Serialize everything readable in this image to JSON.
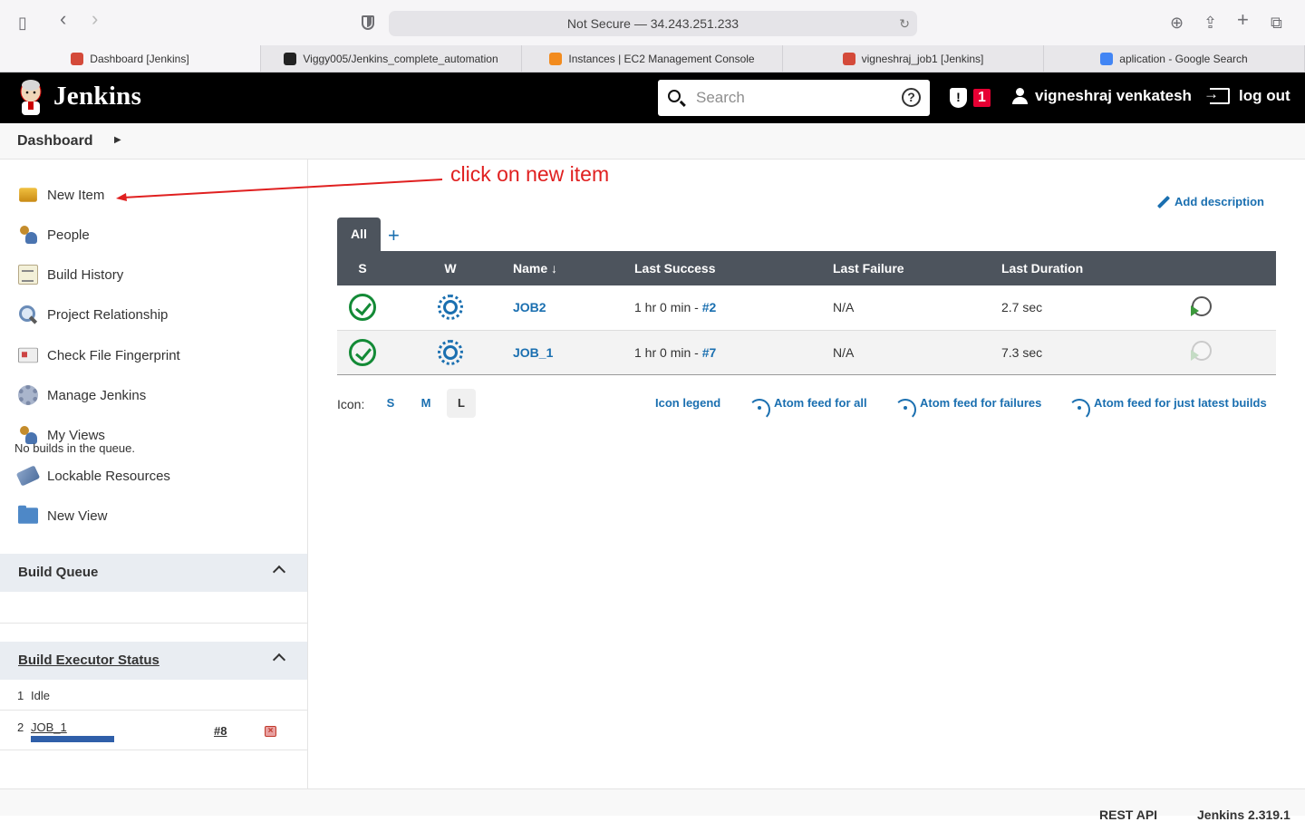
{
  "browser": {
    "url": "Not Secure — 34.243.251.233",
    "tabs": [
      {
        "label": "Dashboard [Jenkins]",
        "color": "#d44a3a"
      },
      {
        "label": "Viggy005/Jenkins_complete_automation",
        "color": "#222222"
      },
      {
        "label": "Instances | EC2 Management Console",
        "color": "#f28b1e"
      },
      {
        "label": "vigneshraj_job1 [Jenkins]",
        "color": "#d44a3a"
      },
      {
        "label": "aplication - Google Search",
        "color": "#4285f4"
      }
    ]
  },
  "header": {
    "title": "Jenkins",
    "search_placeholder": "Search",
    "help": "?",
    "security_mark": "!",
    "alert_count": "1",
    "user": "vigneshraj venkatesh",
    "logout": "log out"
  },
  "breadcrumb": {
    "dashboard": "Dashboard"
  },
  "sidebar": {
    "items": [
      {
        "label": "New Item",
        "icon": "new-item-icon"
      },
      {
        "label": "People",
        "icon": "people-icon"
      },
      {
        "label": "Build History",
        "icon": "notepad-icon"
      },
      {
        "label": "Project Relationship",
        "icon": "magnifier-icon"
      },
      {
        "label": "Check File Fingerprint",
        "icon": "fingerprint-card-icon"
      },
      {
        "label": "Manage Jenkins",
        "icon": "gear-icon"
      },
      {
        "label": "My Views",
        "icon": "people-icon"
      },
      {
        "label": "Lockable Resources",
        "icon": "disk-icon"
      },
      {
        "label": "New View",
        "icon": "folder-icon"
      }
    ],
    "build_queue": {
      "title": "Build Queue",
      "empty": "No builds in the queue."
    },
    "executor": {
      "title": "Build Executor Status",
      "rows": [
        {
          "num": "1",
          "status": "Idle"
        },
        {
          "num": "2",
          "job": "JOB_1",
          "build": "#8",
          "progress_fraction": 0.55
        }
      ]
    }
  },
  "annotation": {
    "text": "click on new item",
    "color": "#e02020"
  },
  "main": {
    "add_description": "Add description",
    "tabs": {
      "all": "All",
      "add": "+"
    },
    "columns": {
      "s": "S",
      "w": "W",
      "name": "Name ↓",
      "last_success": "Last Success",
      "last_failure": "Last Failure",
      "last_duration": "Last Duration"
    },
    "jobs": [
      {
        "name": "JOB2",
        "success_time": "1 hr 0 min - ",
        "success_build": "#2",
        "failure": "N/A",
        "duration": "2.7 sec"
      },
      {
        "name": "JOB_1",
        "success_time": "1 hr 0 min - ",
        "success_build": "#7",
        "failure": "N/A",
        "duration": "7.3 sec"
      }
    ],
    "icon_label": "Icon:",
    "icon_sizes": [
      "S",
      "M",
      "L"
    ],
    "icon_legend": "Icon legend",
    "feed_all": "Atom feed for all",
    "feed_failures": "Atom feed for failures",
    "feed_latest": "Atom feed for just latest builds"
  },
  "footer": {
    "rest_api": "REST API",
    "version": "Jenkins 2.319.1"
  },
  "colors": {
    "header_bg": "#000000",
    "table_header": "#4d545d",
    "link": "#1a6fb0",
    "success": "#138a36"
  }
}
